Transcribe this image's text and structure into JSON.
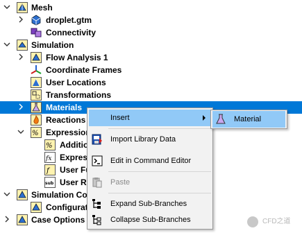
{
  "tree": {
    "mesh": "Mesh",
    "droplet": "droplet.gtm",
    "connectivity": "Connectivity",
    "simulation": "Simulation",
    "flow_analysis": "Flow Analysis 1",
    "coordinate_frames": "Coordinate Frames",
    "user_locations": "User Locations",
    "transformations": "Transformations",
    "materials": "Materials",
    "reactions": "Reactions",
    "expressions": "Expressions",
    "additional": "Additio",
    "expressions_child": "Expres",
    "user_functions": "User Fu",
    "user_routines": "User R",
    "simulation_control": "Simulation Co",
    "configurations": "Configurat",
    "case_options": "Case Options"
  },
  "context_menu": {
    "insert": "Insert",
    "import_library": "Import Library Data",
    "edit_command": "Edit in Command Editor",
    "paste": "Paste",
    "expand": "Expand Sub-Branches",
    "collapse": "Collapse Sub-Branches"
  },
  "submenu": {
    "material": "Material"
  },
  "watermark": {
    "text": "CFD之道"
  },
  "colors": {
    "selection": "#0078d7",
    "menu_hover": "#91c9f7",
    "menu_background": "#f2f2f2"
  }
}
